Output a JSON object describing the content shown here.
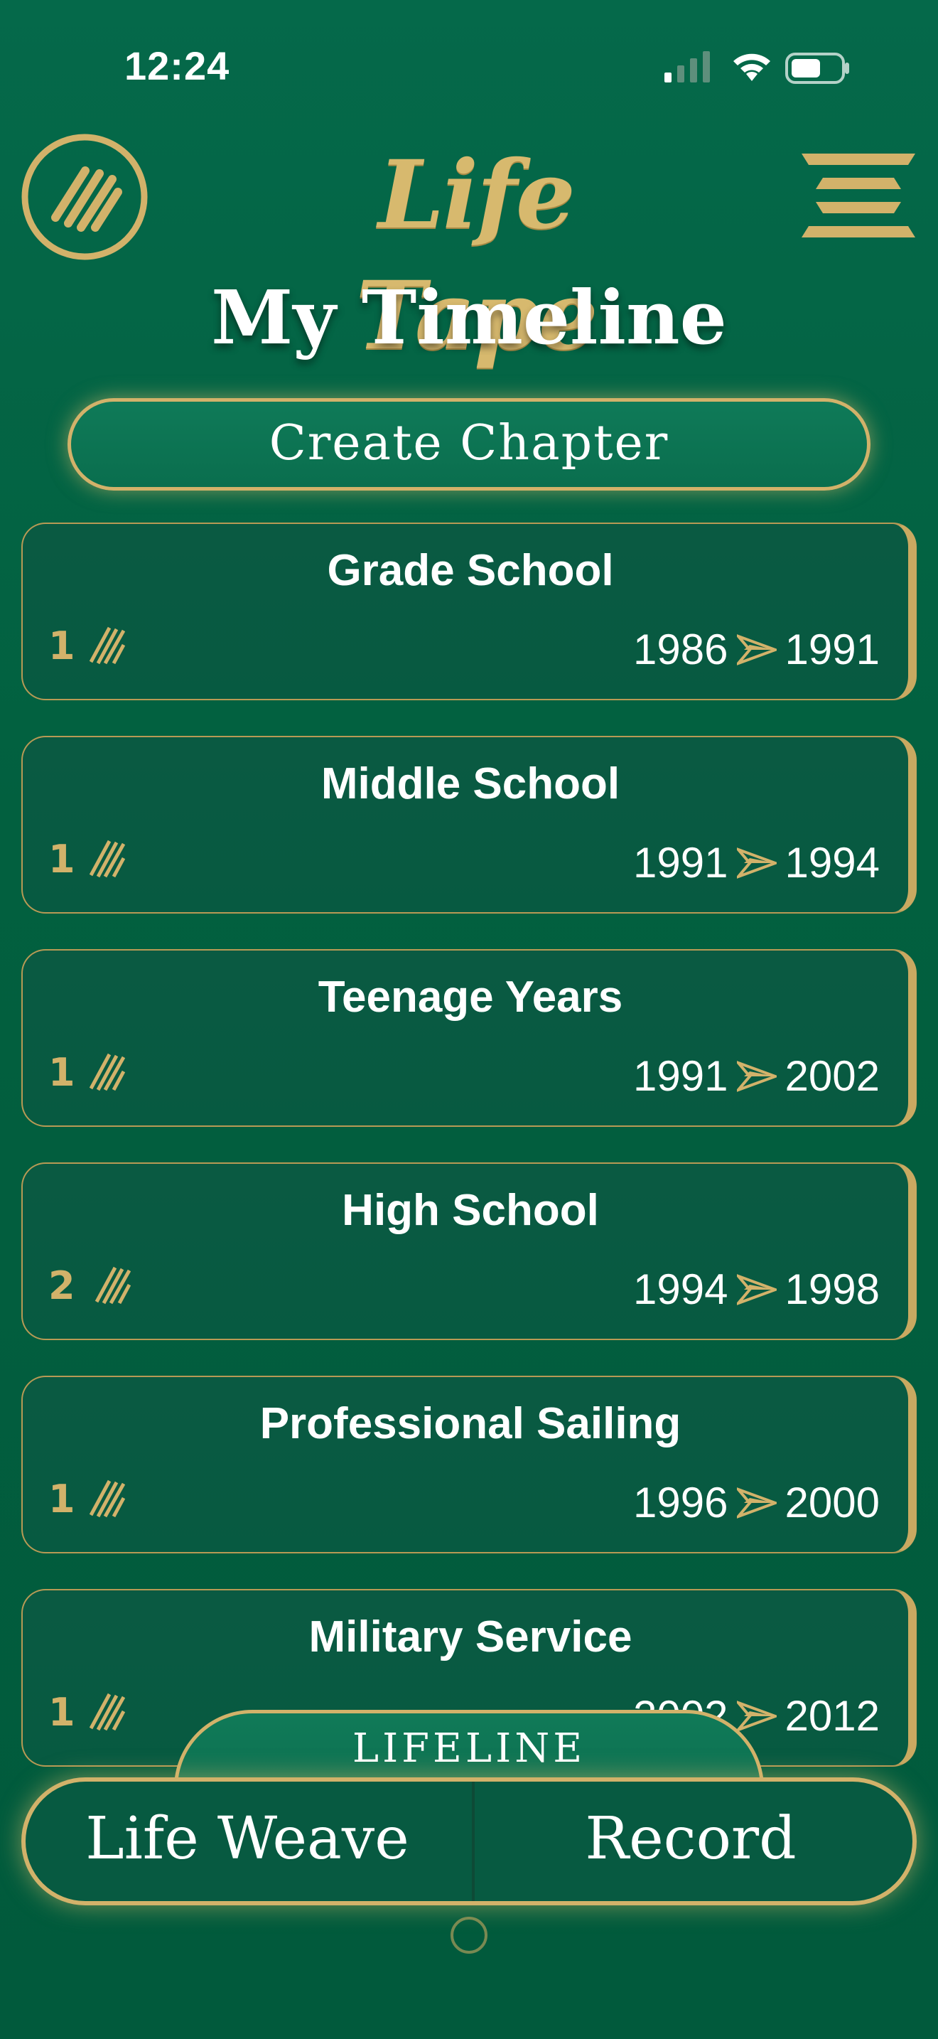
{
  "status_bar": {
    "time": "12:24"
  },
  "header": {
    "app_title": "Life Tape",
    "page_title": "My Timeline"
  },
  "actions": {
    "create_chapter": "Create Chapter"
  },
  "chapters": [
    {
      "title": "Grade School",
      "count": "1",
      "start": "1986",
      "end": "1991"
    },
    {
      "title": "Middle School",
      "count": "1",
      "start": "1991",
      "end": "1994"
    },
    {
      "title": "Teenage Years",
      "count": "1",
      "start": "1991",
      "end": "2002"
    },
    {
      "title": "High School",
      "count": "2",
      "start": "1994",
      "end": "1998"
    },
    {
      "title": "Professional Sailing",
      "count": "1",
      "start": "1996",
      "end": "2000"
    },
    {
      "title": "Military Service",
      "count": "1",
      "start": "2002",
      "end": "2012"
    }
  ],
  "bottom_nav": {
    "lifeline": "LIFELINE",
    "left": "Life Weave",
    "right": "Record"
  },
  "colors": {
    "background": "#02603f",
    "gold": "#d2b26a",
    "card": "#075a41"
  },
  "icons": [
    "signal-icon",
    "wifi-icon",
    "battery-icon",
    "tape-logo-icon",
    "menu-icon",
    "tape-icon",
    "arrow-right-icon"
  ]
}
